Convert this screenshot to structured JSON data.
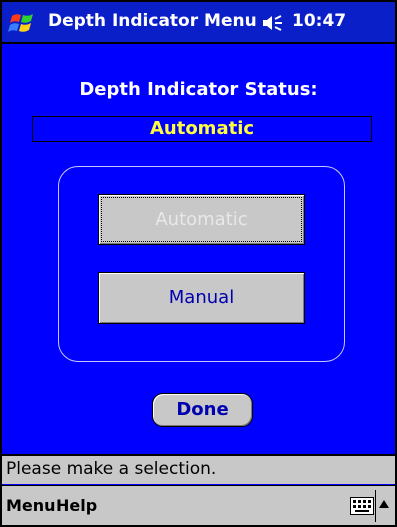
{
  "titlebar": {
    "title": "Depth Indicator Menu",
    "time": "10:47",
    "start_icon": "windows-flag-icon",
    "speaker_icon": "speaker-icon"
  },
  "status": {
    "heading": "Depth Indicator Status:",
    "value": "Automatic"
  },
  "buttons": {
    "automatic_label": "Automatic",
    "manual_label": "Manual",
    "done_label": "Done"
  },
  "statusbar": {
    "message": "Please make a selection."
  },
  "menubar": {
    "menu_label": "Menu",
    "help_label": "Help",
    "keyboard_icon": "keyboard-icon",
    "arrow_icon": "up-arrow-icon"
  },
  "colors": {
    "background": "#0000ff",
    "titlebar": "#0a1fc8",
    "status_value": "#ffff40",
    "button_face": "#c8c8c8",
    "button_text": "#0000b0"
  }
}
